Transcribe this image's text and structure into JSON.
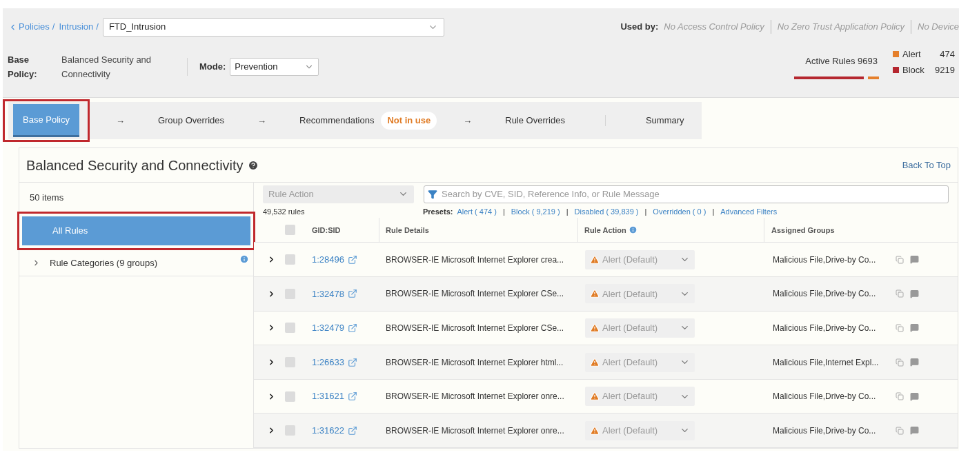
{
  "breadcrumb": [
    {
      "label": "Policies",
      "separator": "/"
    },
    {
      "label": "Intrusion",
      "separator": "/"
    }
  ],
  "policy_select": {
    "value": "FTD_Intrusion"
  },
  "used_by": {
    "label": "Used by:",
    "items": [
      "No Access Control Policy",
      "No Zero Trust Application Policy",
      "No Device"
    ]
  },
  "base_policy": {
    "label": "Base Policy:",
    "value": "Balanced Security and Connectivity"
  },
  "mode": {
    "label": "Mode:",
    "value": "Prevention"
  },
  "active_rules": {
    "label": "Active Rules 9693",
    "legend": [
      {
        "label": "Alert",
        "count": "474",
        "color": "#e57f2b"
      },
      {
        "label": "Block",
        "count": "9219",
        "color": "#b5272f"
      }
    ]
  },
  "steps": [
    {
      "label": "Base Policy",
      "selected": true,
      "highlighted": true,
      "arrow": "→"
    },
    {
      "label": "Group Overrides",
      "selected": false,
      "highlighted": false,
      "arrow": "→"
    },
    {
      "label": "Recommendations",
      "badge": "Not in use",
      "selected": false,
      "highlighted": false,
      "arrow": "→"
    },
    {
      "label": "Rule Overrides",
      "selected": false,
      "highlighted": false
    },
    {
      "label": "Summary",
      "selected": false,
      "highlighted": false
    }
  ],
  "panel": {
    "title": "Balanced Security and Connectivity",
    "back_to_top": "Back To Top"
  },
  "sidebar": {
    "count": "50 items",
    "items": [
      {
        "label": "All Rules",
        "kind": "item",
        "selected": true,
        "highlighted": true
      },
      {
        "label": "Rule Categories (9 groups)",
        "kind": "group",
        "selected": false,
        "highlighted": false,
        "expanded": false
      }
    ]
  },
  "filters": {
    "rule_action": {
      "placeholder": "Rule Action"
    },
    "search": {
      "placeholder": "Search by CVE, SID, Reference Info, or Rule Message"
    }
  },
  "rule_count": "49,532 rules",
  "presets": {
    "label": "Presets:",
    "separator": "|",
    "items": [
      "Alert ( 474 )",
      "Block ( 9,219 )",
      "Disabled ( 39,839 )",
      "Overridden ( 0 )",
      "Advanced Filters"
    ]
  },
  "table": {
    "select_all": {
      "checked": false
    },
    "columns": [
      "GID:SID",
      "Rule Details",
      "Rule Action",
      "Assigned Groups"
    ],
    "rows": [
      {
        "gid_sid": "1:28496",
        "details": "BROWSER-IE Microsoft Internet Explorer crea...",
        "action": "Alert (Default)",
        "groups": "Malicious File,Drive-by Co...",
        "checked": false,
        "expanded": false
      },
      {
        "gid_sid": "1:32478",
        "details": "BROWSER-IE Microsoft Internet Explorer CSe...",
        "action": "Alert (Default)",
        "groups": "Malicious File,Drive-by Co...",
        "checked": false,
        "expanded": false
      },
      {
        "gid_sid": "1:32479",
        "details": "BROWSER-IE Microsoft Internet Explorer CSe...",
        "action": "Alert (Default)",
        "groups": "Malicious File,Drive-by Co...",
        "checked": false,
        "expanded": false
      },
      {
        "gid_sid": "1:26633",
        "details": "BROWSER-IE Microsoft Internet Explorer html...",
        "action": "Alert (Default)",
        "groups": "Malicious File,Internet Expl...",
        "checked": false,
        "expanded": false
      },
      {
        "gid_sid": "1:31621",
        "details": "BROWSER-IE Microsoft Internet Explorer onre...",
        "action": "Alert (Default)",
        "groups": "Malicious File,Drive-by Co...",
        "checked": false,
        "expanded": false
      },
      {
        "gid_sid": "1:31622",
        "details": "BROWSER-IE Microsoft Internet Explorer onre...",
        "action": "Alert (Default)",
        "groups": "Malicious File,Drive-by Co...",
        "checked": false,
        "expanded": false
      }
    ]
  }
}
